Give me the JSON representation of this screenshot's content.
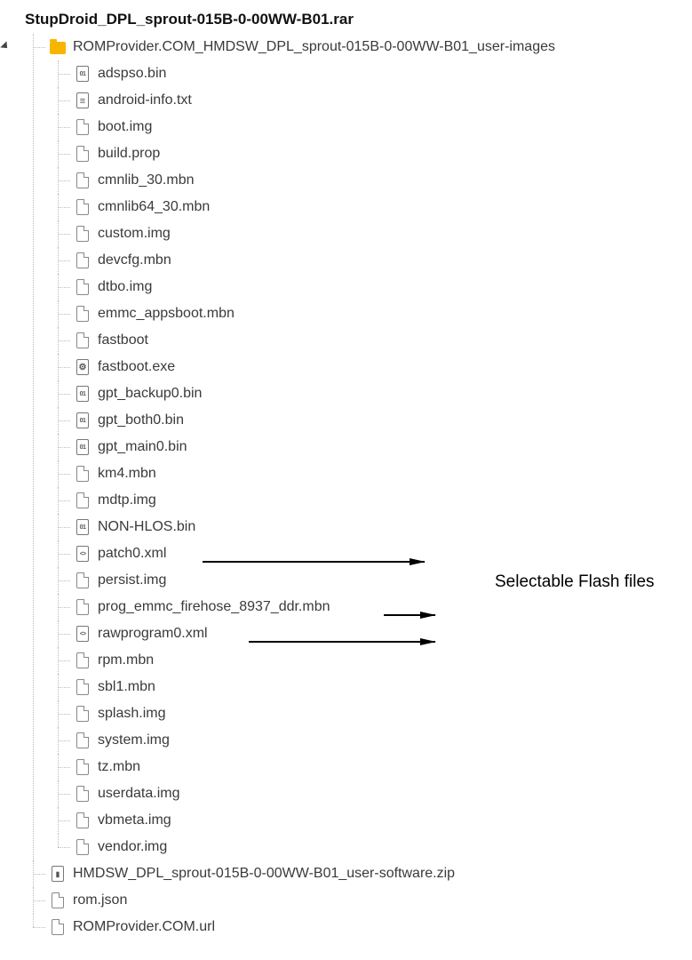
{
  "root": "StupDroid_DPL_sprout-015B-0-00WW-B01.rar",
  "folder": {
    "name": "ROMProvider.COM_HMDSW_DPL_sprout-015B-0-00WW-B01_user-images",
    "children": [
      {
        "n": "adspso.bin",
        "t": "bin"
      },
      {
        "n": "android-info.txt",
        "t": "txt"
      },
      {
        "n": "boot.img",
        "t": "file"
      },
      {
        "n": "build.prop",
        "t": "file"
      },
      {
        "n": "cmnlib_30.mbn",
        "t": "file"
      },
      {
        "n": "cmnlib64_30.mbn",
        "t": "file"
      },
      {
        "n": "custom.img",
        "t": "file"
      },
      {
        "n": "devcfg.mbn",
        "t": "file"
      },
      {
        "n": "dtbo.img",
        "t": "file"
      },
      {
        "n": "emmc_appsboot.mbn",
        "t": "file"
      },
      {
        "n": "fastboot",
        "t": "file"
      },
      {
        "n": "fastboot.exe",
        "t": "exe"
      },
      {
        "n": "gpt_backup0.bin",
        "t": "bin"
      },
      {
        "n": "gpt_both0.bin",
        "t": "bin"
      },
      {
        "n": "gpt_main0.bin",
        "t": "bin"
      },
      {
        "n": "km4.mbn",
        "t": "file"
      },
      {
        "n": "mdtp.img",
        "t": "file"
      },
      {
        "n": "NON-HLOS.bin",
        "t": "bin"
      },
      {
        "n": "patch0.xml",
        "t": "xml"
      },
      {
        "n": "persist.img",
        "t": "file"
      },
      {
        "n": "prog_emmc_firehose_8937_ddr.mbn",
        "t": "file"
      },
      {
        "n": "rawprogram0.xml",
        "t": "xml"
      },
      {
        "n": "rpm.mbn",
        "t": "file"
      },
      {
        "n": "sbl1.mbn",
        "t": "file"
      },
      {
        "n": "splash.img",
        "t": "file"
      },
      {
        "n": "system.img",
        "t": "file"
      },
      {
        "n": "tz.mbn",
        "t": "file"
      },
      {
        "n": "userdata.img",
        "t": "file"
      },
      {
        "n": "vbmeta.img",
        "t": "file"
      },
      {
        "n": "vendor.img",
        "t": "file"
      }
    ]
  },
  "siblings": [
    {
      "n": "HMDSW_DPL_sprout-015B-0-00WW-B01_user-software.zip",
      "t": "zip"
    },
    {
      "n": "rom.json",
      "t": "file"
    },
    {
      "n": "ROMProvider.COM.url",
      "t": "file"
    }
  ],
  "annotation": "Selectable Flash files"
}
